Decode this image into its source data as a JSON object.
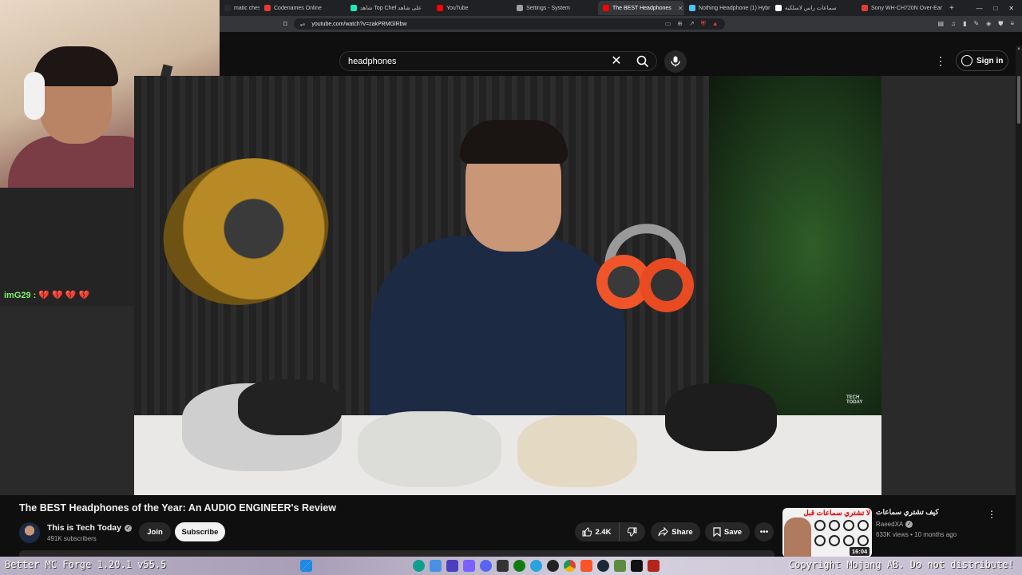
{
  "browser": {
    "tabs": [
      {
        "label": "matic chest - Y",
        "color": "#2b2b2b"
      },
      {
        "label": "Codenames Online",
        "color": "#e53935"
      },
      {
        "label": "شاهد Top Chef على شاهد",
        "color": "#1de9b6"
      },
      {
        "label": "YouTube",
        "color": "#ff0000"
      },
      {
        "label": "Settings - System",
        "color": "#9e9e9e"
      },
      {
        "label": "The BEST Headphones",
        "color": "#ff0000",
        "active": true
      },
      {
        "label": "Nothing Headphone (1) Hybri",
        "color": "#4fc3f7"
      },
      {
        "label": "سماعات راس لاسلكية",
        "color": "#ffffff"
      },
      {
        "label": "Sony WH-CH720N Over-Ear H",
        "color": "#e53935"
      }
    ],
    "new_tab": "+",
    "url": "youtube.com/watch?v=zakPRMGlRbw"
  },
  "header": {
    "search_value": "headphones",
    "sign_in": "Sign in"
  },
  "chat": {
    "user": "imG29 :",
    "message": "💔 💔 💔 💔"
  },
  "video": {
    "watermark_line1": "TECH",
    "watermark_line2": "TODAY",
    "title": "The BEST Headphones of the Year: An AUDIO ENGINEER's Review"
  },
  "channel": {
    "name": "This is Tech Today",
    "subscribers": "491K subscribers",
    "join": "Join",
    "subscribe": "Subscribe"
  },
  "actions": {
    "likes": "2.4K",
    "share": "Share",
    "save": "Save"
  },
  "recommended": {
    "thumb_text": "لا تشتري سماعات قبل",
    "duration": "16:04",
    "title": "كيف تشتري سماعات",
    "channel": "RaeedXA",
    "meta": "633K views • 10 months ago"
  },
  "overlay": {
    "left_text": "Better MC Forge 1.20.1 v55.5",
    "right_text": "Copyright Mojang AB. Do not distribute!"
  },
  "colors": {
    "yt_bg": "#0f0f0f",
    "button_bg": "#272727",
    "chat_user": "#7df26b"
  }
}
